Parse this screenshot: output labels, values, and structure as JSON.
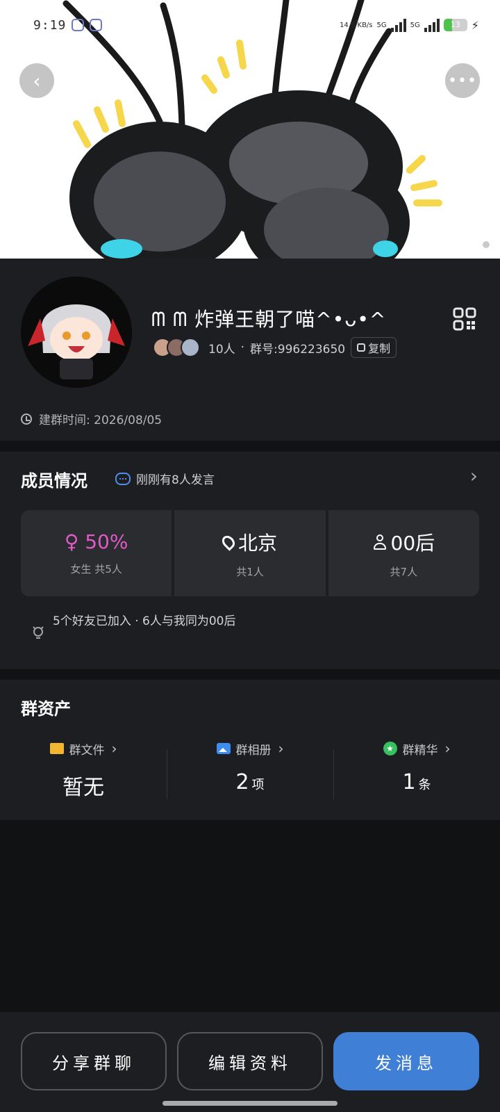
{
  "status_bar": {
    "time": "9:19",
    "net_speed": "14.5 KB/s",
    "net_1": "5G",
    "net_2": "5G",
    "battery": "13"
  },
  "header": {
    "back_icon": "chevron-left-icon",
    "more_icon": "ellipsis-icon"
  },
  "group": {
    "name": "ᗰ ᗰ 炸弹王朝了喵^•ᴗ•^",
    "member_count": "10人",
    "separator": "·",
    "group_id": "群号:996223650",
    "copy_label": "复制",
    "created": "建群时间: 2026/08/05"
  },
  "members": {
    "title": "成员情况",
    "activity": "刚刚有8人发言",
    "stats": [
      {
        "value": "♀ 50%",
        "caption": "女生 共5人"
      },
      {
        "value": "北京",
        "caption": "共1人"
      },
      {
        "value": "00后",
        "caption": "共7人"
      }
    ],
    "friends_note": "5个好友已加入 · 6人与我同为00后"
  },
  "assets": {
    "title": "群资产",
    "items": [
      {
        "label": "群文件",
        "value": "暂无",
        "unit": ""
      },
      {
        "label": "群相册",
        "value": "2",
        "unit": "项"
      },
      {
        "label": "群精华",
        "value": "1",
        "unit": "条"
      }
    ]
  },
  "actions": {
    "share": "分享群聊",
    "edit": "编辑资料",
    "send": "发消息"
  },
  "colors": {
    "accent": "#3f7fd6",
    "female": "#e259c9",
    "card": "#1d1e21"
  }
}
